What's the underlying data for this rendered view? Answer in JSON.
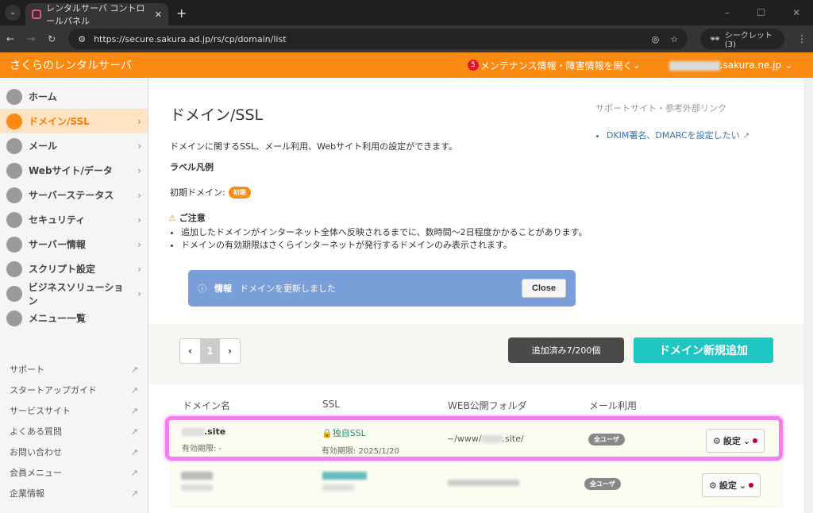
{
  "browser": {
    "tab_title": "レンタルサーバ コントロールパネル",
    "url": "https://secure.sakura.ad.jp/rs/cp/domain/list",
    "incognito": "シークレット (3)"
  },
  "header": {
    "brand": "さくらのレンタルサーバ",
    "notif_count": "5",
    "maintenance": "メンテナンス情報・障害情報を開く",
    "account": ".sakura.ne.jp"
  },
  "sidebar": {
    "items": [
      {
        "label": "ホーム"
      },
      {
        "label": "ドメイン/SSL"
      },
      {
        "label": "メール"
      },
      {
        "label": "Webサイト/データ"
      },
      {
        "label": "サーバーステータス"
      },
      {
        "label": "セキュリティ"
      },
      {
        "label": "サーバー情報"
      },
      {
        "label": "スクリプト設定"
      },
      {
        "label": "ビジネスソリューション"
      },
      {
        "label": "メニュー一覧"
      }
    ],
    "links": [
      "サポート",
      "スタートアップガイド",
      "サービスサイト",
      "よくある質問",
      "お問い合わせ",
      "会員メニュー",
      "企業情報"
    ]
  },
  "main": {
    "title": "ドメイン/SSL",
    "description": "ドメインに関するSSL、メール利用、Webサイト利用の設定ができます。",
    "legend_label": "ラベル凡例",
    "initial_domain": "初期ドメイン:",
    "initial_chip": "初期",
    "notice_title": "ご注意",
    "notices": [
      "追加したドメインがインターネット全体へ反映されるまでに、数時間〜2日程度かかることがあります。",
      "ドメインの有効期限はさくらインターネットが発行するドメインのみ表示されます。"
    ],
    "info_label": "情報",
    "info_message": "ドメインを更新しました",
    "close": "Close",
    "support_title": "サポートサイト・参考外部リンク",
    "support_link": "DKIM署名、DMARCを設定したい",
    "page": "1",
    "count": "追加済み7/200個",
    "add_button": "ドメイン新規追加",
    "columns": [
      "ドメイン名",
      "SSL",
      "WEB公開フォルダ",
      "メール利用"
    ],
    "rows": [
      {
        "domain": ".site",
        "expiry": "有効期限: -",
        "ssl": "独自SSL",
        "ssl_expiry": "有効期限: 2025/1/20",
        "folder_prefix": "~/www/",
        "folder_suffix": ".site/",
        "mail": "全ユーザ",
        "settings": "設定"
      },
      {
        "mail": "全ユーザ",
        "settings": "設定"
      }
    ]
  },
  "colors": {
    "brand": "#fb8a12",
    "highlight": "#f57ef0",
    "add": "#1fc7c4"
  }
}
